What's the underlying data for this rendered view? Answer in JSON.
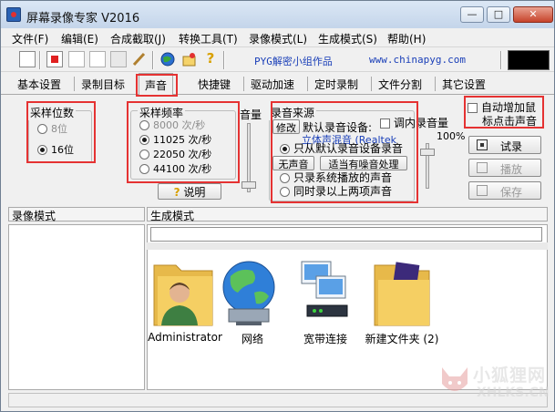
{
  "window": {
    "title": "屏幕录像专家 V2016",
    "min": "—",
    "max": "□",
    "close": "✕"
  },
  "menu": [
    "文件(F)",
    "编辑(E)",
    "合成截取(J)",
    "转换工具(T)",
    "录像模式(L)",
    "生成模式(S)",
    "帮助(H)"
  ],
  "toolbar": {
    "credit": "PYG解密小组作品",
    "url": "www.chinapyg.com"
  },
  "tabs": [
    "基本设置",
    "录制目标",
    "声音",
    "快捷键",
    "驱动加速",
    "定时录制",
    "文件分割",
    "其它设置"
  ],
  "active_tab": "声音",
  "bits": {
    "title": "采样位数",
    "opt8": "8位",
    "opt16": "16位"
  },
  "rate": {
    "title": "采样频率",
    "r8000": "8000 次/秒",
    "r11025": "11025 次/秒",
    "r22050": "22050 次/秒",
    "r44100": "44100 次/秒",
    "help": "说明"
  },
  "volume_label": "音量",
  "source": {
    "title": "录音来源",
    "modify": "修改",
    "default_device": "默认录音设备:",
    "device_name": "立体声混音 (Realtek",
    "adjust_volume": "调内录音量",
    "only_default": "只从默认录音设备录音",
    "no_sound": "无声音",
    "suitable_noise": "适当有噪音处理",
    "only_system": "只录系统播放的声音",
    "both": "同时录以上两项声音",
    "percent": "100%"
  },
  "auto_click": {
    "line1": "自动增加鼠",
    "line2": "标点击声音"
  },
  "side_buttons": {
    "test": "试录",
    "play": "播放",
    "save": "保存"
  },
  "panes": {
    "left": "录像模式",
    "right": "生成模式"
  },
  "files": [
    {
      "label": "Administrator",
      "icon": "user-folder-icon"
    },
    {
      "label": "网络",
      "icon": "network-globe-icon"
    },
    {
      "label": "宽带连接",
      "icon": "broadband-connection-icon"
    },
    {
      "label": "新建文件夹 (2)",
      "icon": "folder-icon"
    }
  ],
  "watermark": {
    "cn": "小狐狸网",
    "en": "XHLKS.CN"
  },
  "colors": {
    "highlight": "#e53232",
    "title_gradient": "#c4d5ea",
    "link": "#1a3fb8"
  }
}
